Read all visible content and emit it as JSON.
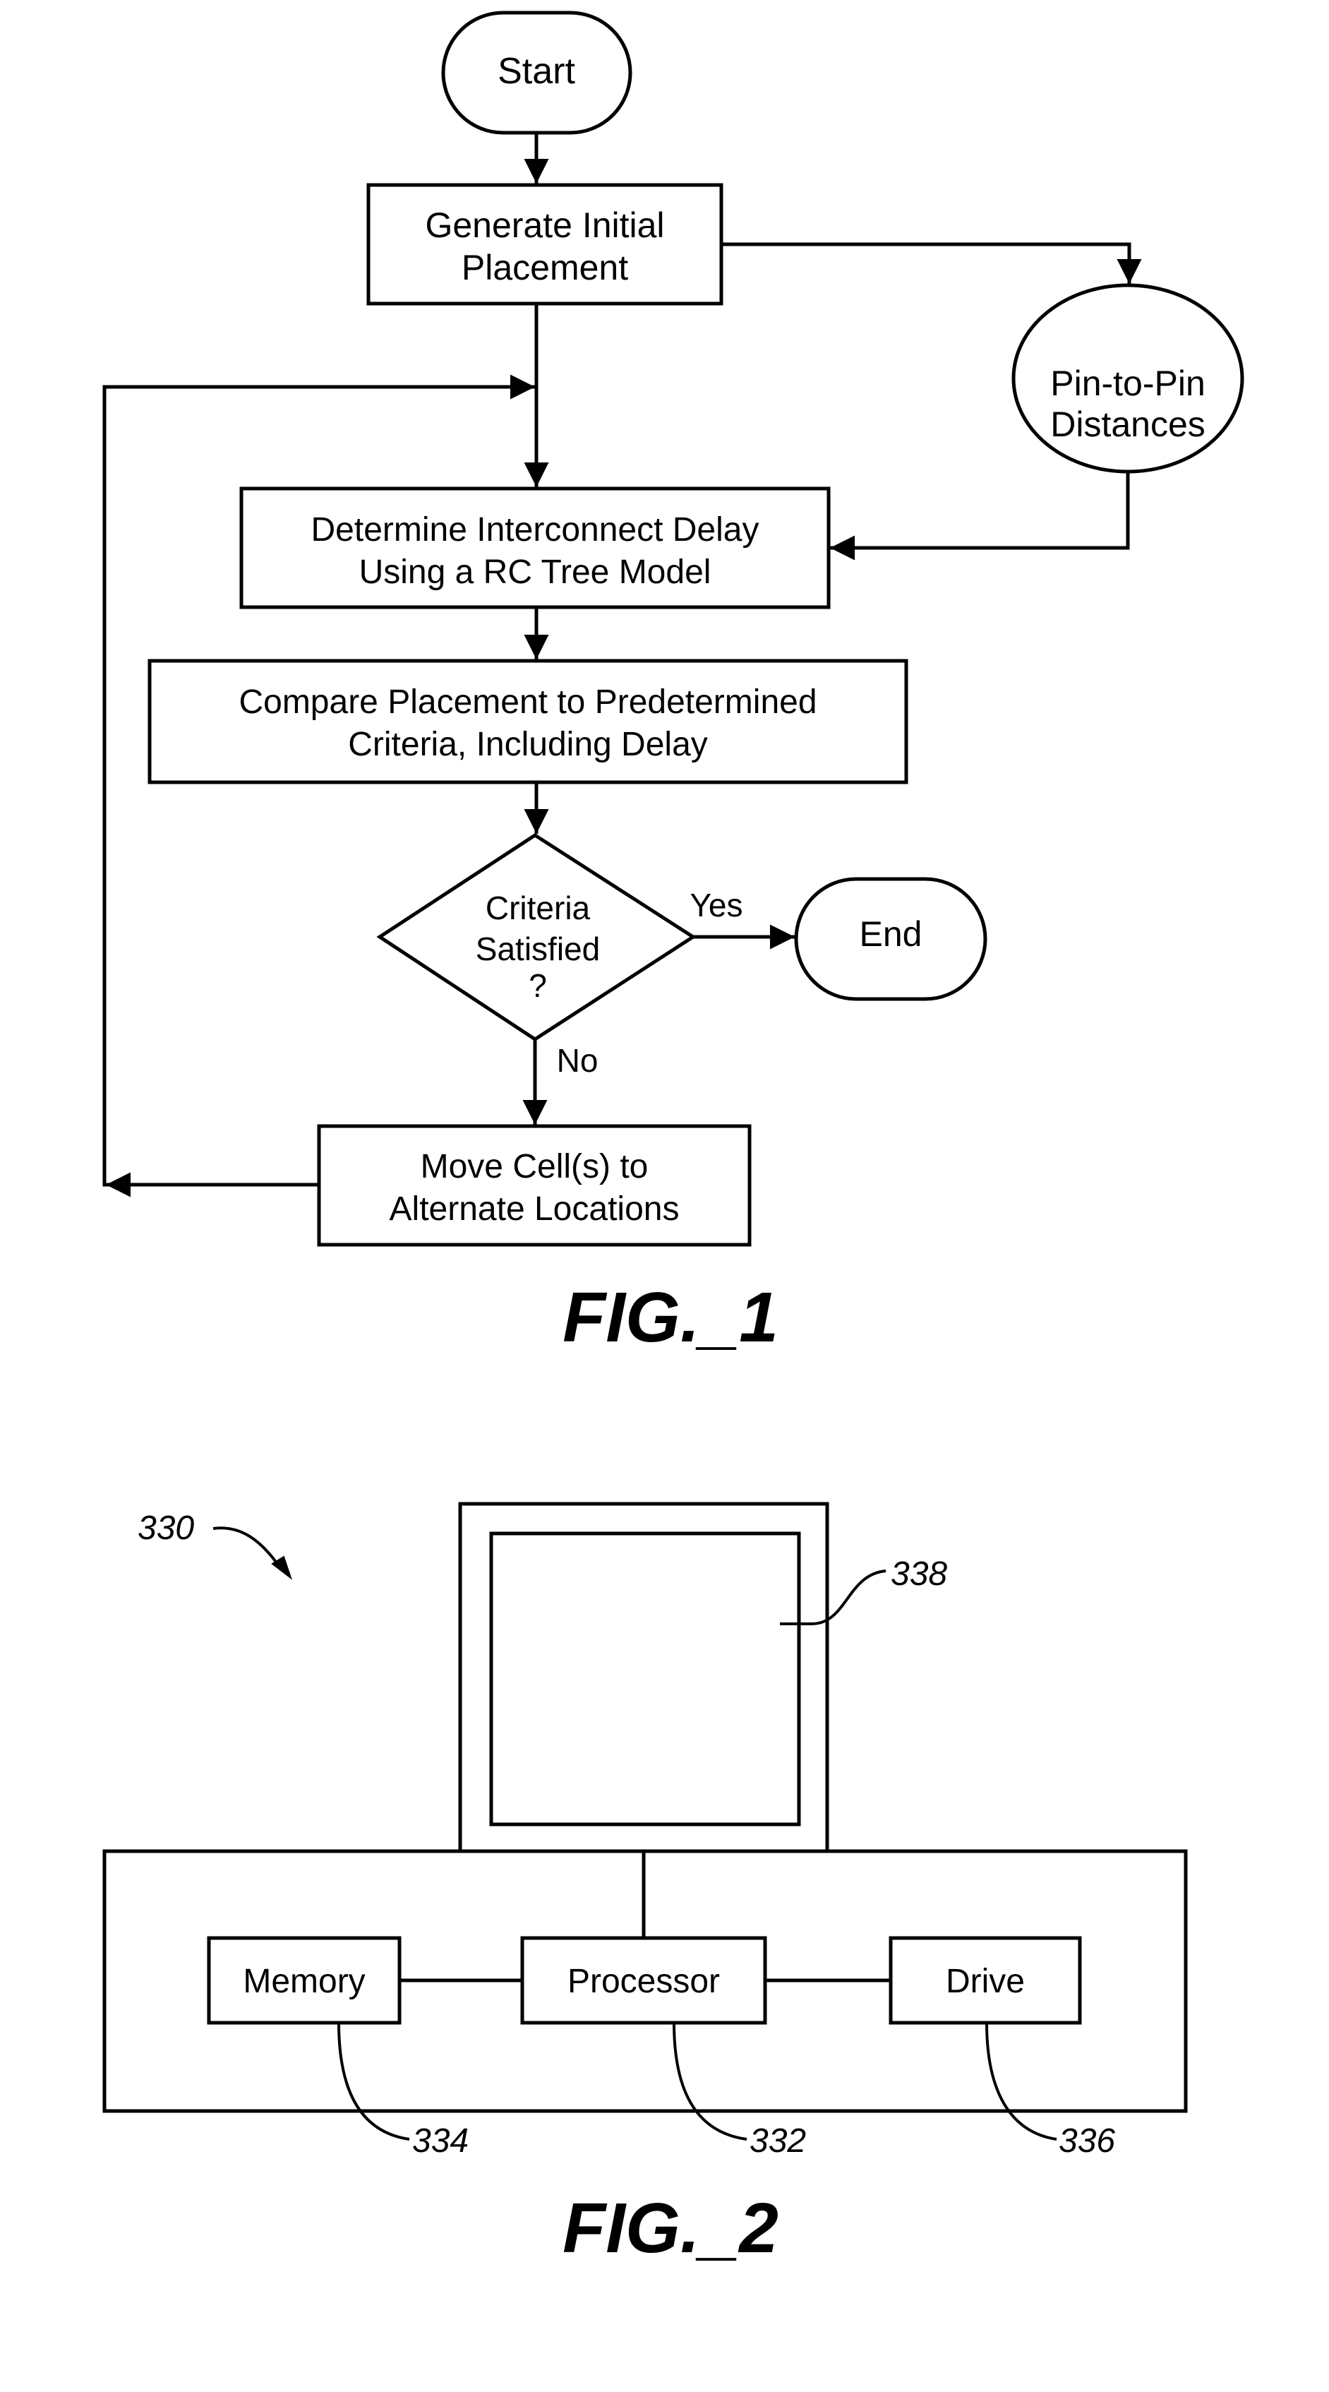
{
  "fig1": {
    "caption": "FIG._1",
    "nodes": {
      "start": "Start",
      "generate": [
        "Generate Initial",
        "Placement"
      ],
      "pins": [
        "Pin-to-Pin",
        "Distances"
      ],
      "determine": [
        "Determine Interconnect Delay",
        "Using a RC Tree Model"
      ],
      "compare": [
        "Compare Placement to Predetermined",
        "Criteria, Including Delay"
      ],
      "decision": [
        "Criteria",
        "Satisfied",
        "?"
      ],
      "end": "End",
      "move": [
        "Move Cell(s) to",
        "Alternate Locations"
      ]
    },
    "edge_labels": {
      "yes": "Yes",
      "no": "No"
    }
  },
  "fig2": {
    "caption": "FIG._2",
    "components": {
      "memory": "Memory",
      "processor": "Processor",
      "drive": "Drive"
    },
    "refs": {
      "system": "330",
      "processor": "332",
      "memory": "334",
      "drive": "336",
      "display": "338"
    }
  }
}
